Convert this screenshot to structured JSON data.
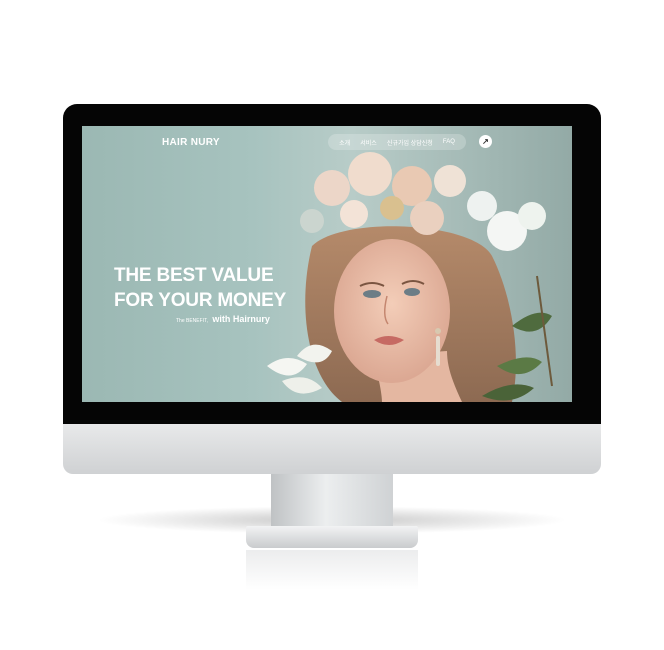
{
  "brand": "HAIR NURY",
  "nav": {
    "items": [
      "소개",
      "서비스",
      "신규가입 상담신청",
      "FAQ"
    ],
    "action_icon": "arrow-up-right-icon"
  },
  "hero": {
    "headline_line1": "THE BEST VALUE",
    "headline_line2": "FOR YOUR MONEY",
    "tagline_prefix": "The BENEFIT,",
    "tagline_main": "with Hairnury"
  },
  "colors": {
    "screen_bg": "#a7c3bf",
    "text": "#ffffff",
    "bezel": "#050505"
  }
}
